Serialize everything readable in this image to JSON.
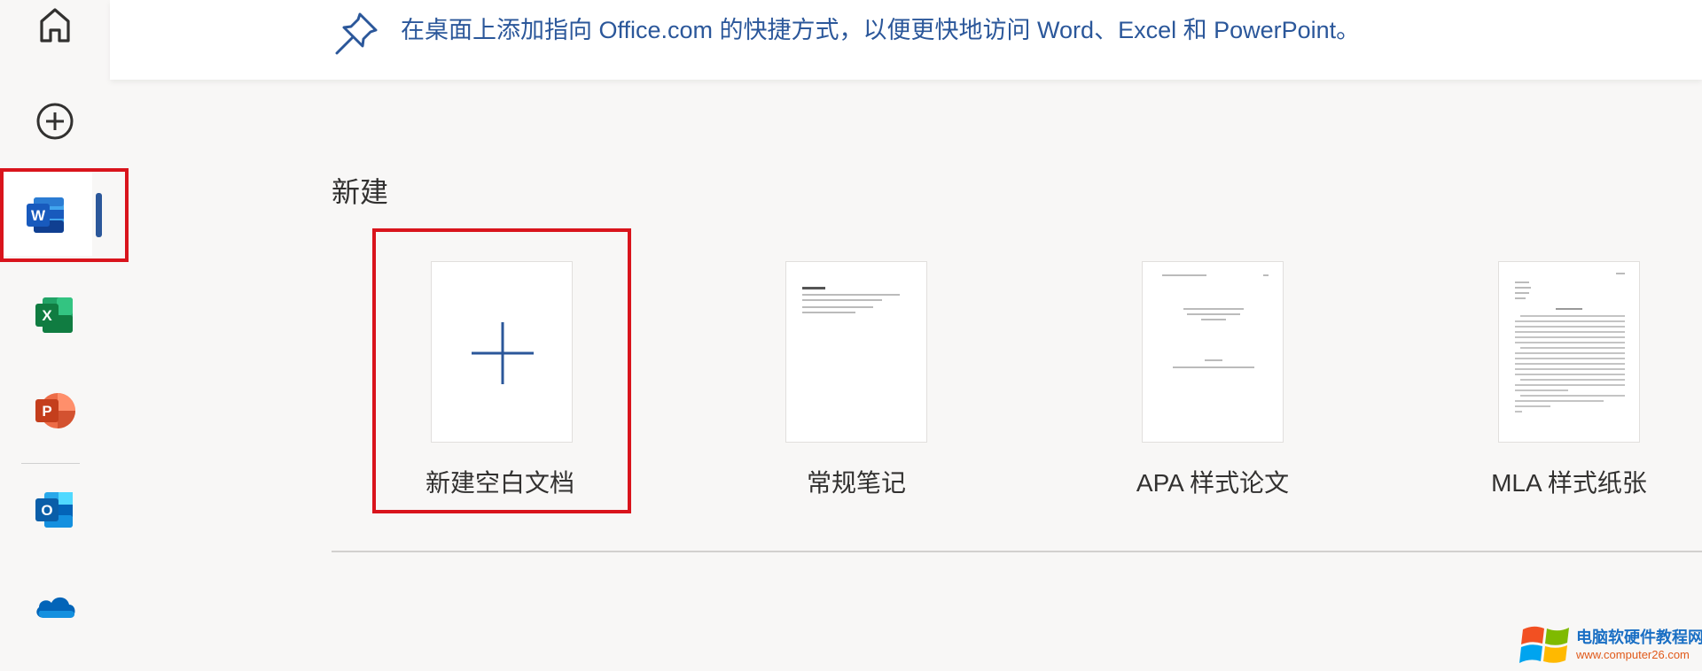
{
  "banner": {
    "text": "在桌面上添加指向 Office.com 的快捷方式，以便更快地访问 Word、Excel 和 PowerPoint。",
    "accent": "#2b579a"
  },
  "rail": {
    "items": [
      {
        "name": "home",
        "icon": "home-icon"
      },
      {
        "name": "create",
        "icon": "plus-circle-icon"
      },
      {
        "name": "word",
        "icon": "word-icon",
        "active": true
      },
      {
        "name": "excel",
        "icon": "excel-icon"
      },
      {
        "name": "powerpoint",
        "icon": "powerpoint-icon"
      },
      {
        "name": "outlook",
        "icon": "outlook-icon"
      },
      {
        "name": "onedrive",
        "icon": "onedrive-icon"
      }
    ]
  },
  "section": {
    "title": "新建",
    "templates": [
      {
        "label": "新建空白文档"
      },
      {
        "label": "常规笔记"
      },
      {
        "label": "APA 样式论文"
      },
      {
        "label": "MLA 样式纸张"
      }
    ]
  },
  "watermark": {
    "site": "电脑软硬件教程网",
    "url": "www.computer26.com"
  },
  "colors": {
    "word": "#2b579a",
    "excel": "#217346",
    "powerpoint": "#d24726",
    "outlook": "#0078d4",
    "onedrive": "#0364b8",
    "highlight": "#d9141c"
  }
}
